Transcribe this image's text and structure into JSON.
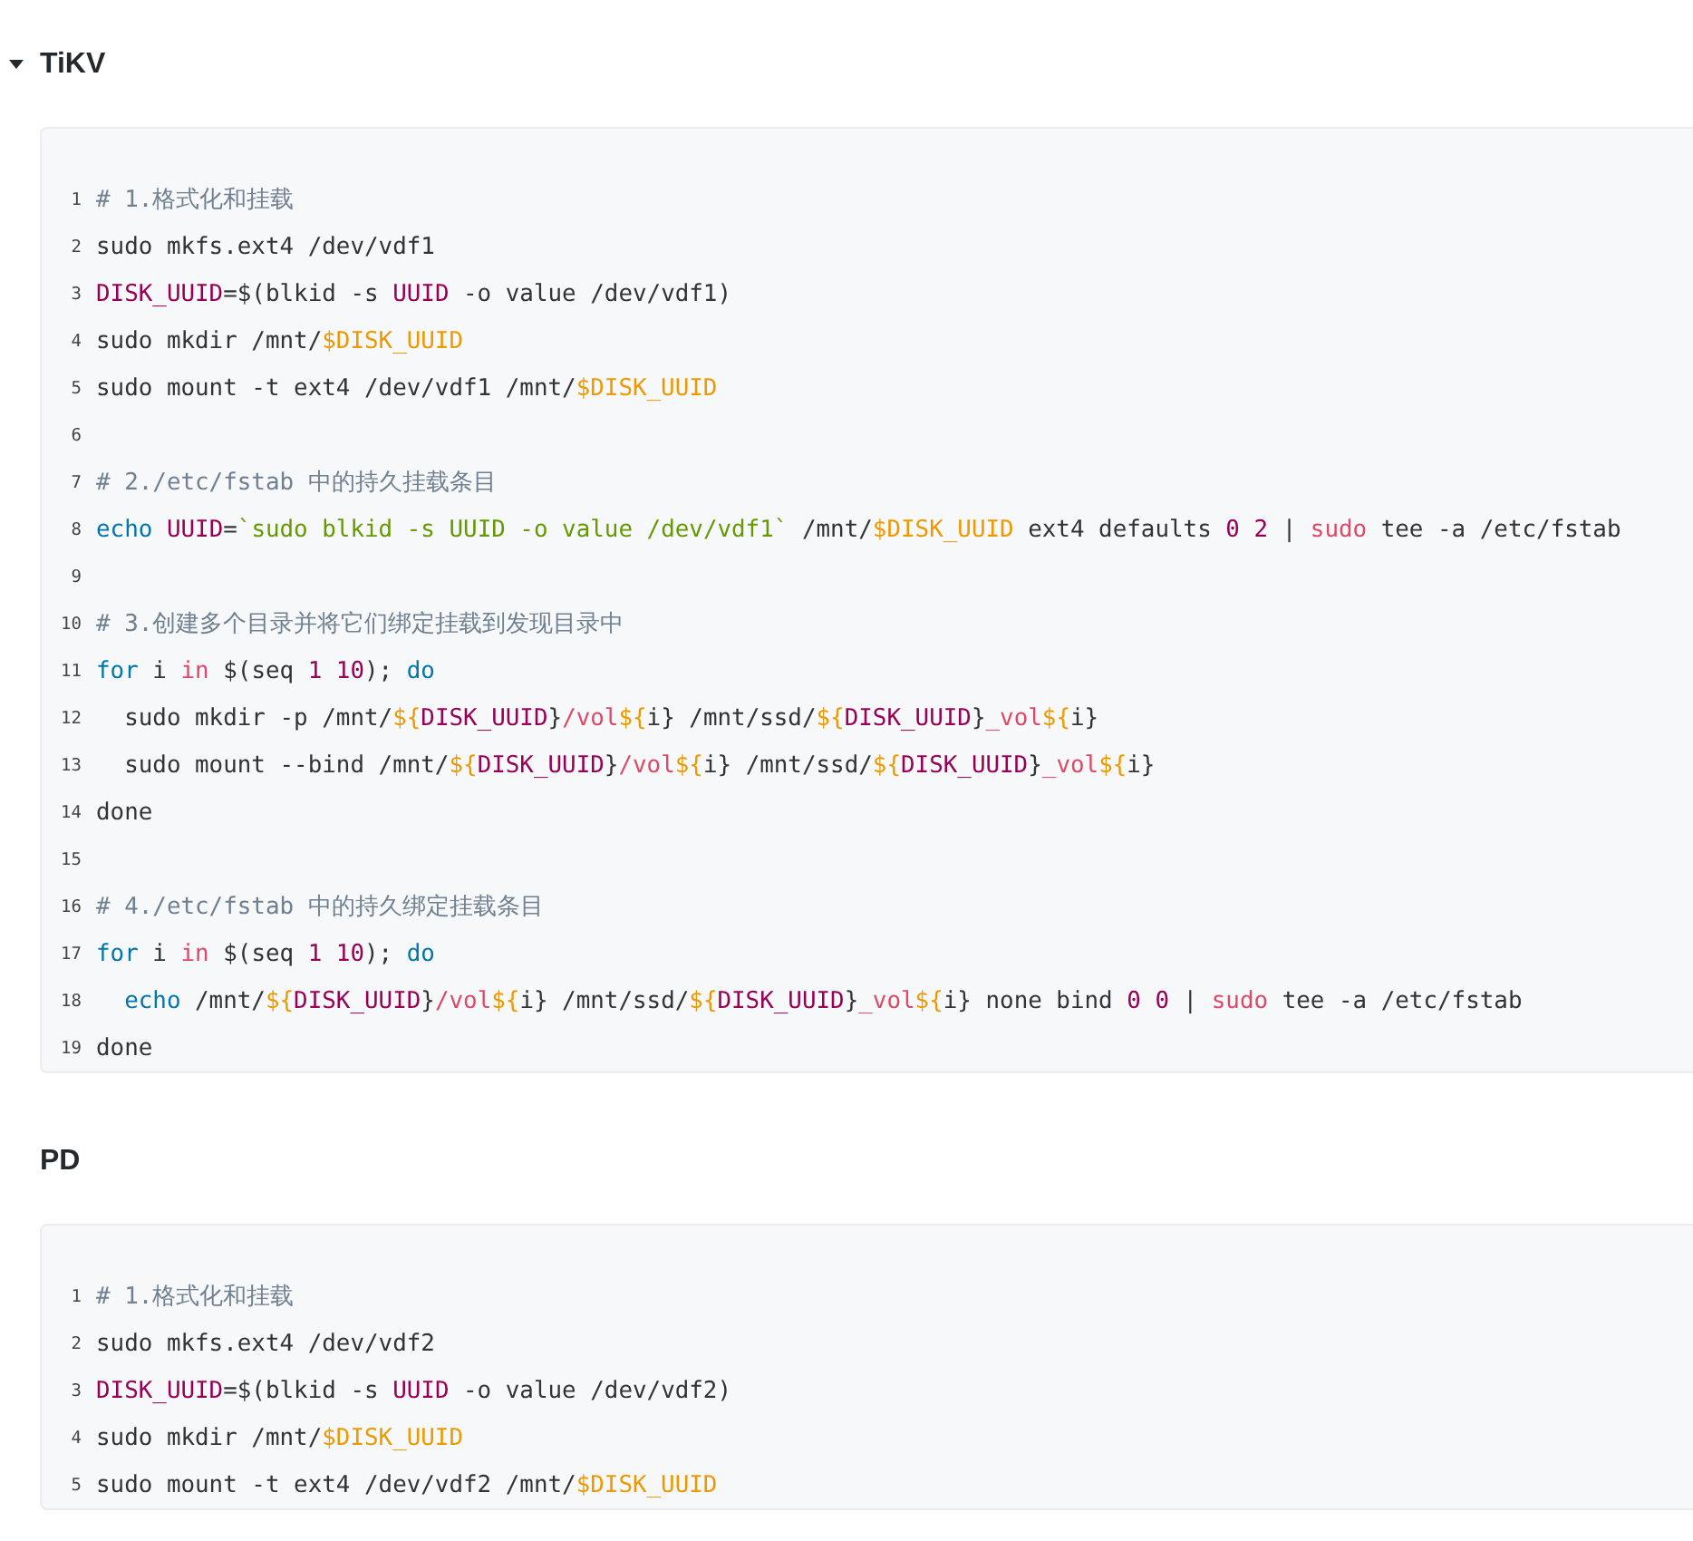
{
  "sections": [
    {
      "title": "TiKV",
      "expanded": true,
      "lines": [
        {
          "number": "1",
          "tokens": [
            {
              "kind": "comment",
              "text": "# 1.格式化和挂载"
            }
          ]
        },
        {
          "number": "2",
          "tokens": [
            {
              "kind": "plain",
              "text": "sudo mkfs.ext4 /dev/vdf1"
            }
          ]
        },
        {
          "number": "3",
          "tokens": [
            {
              "kind": "variable",
              "text": "DISK_UUID"
            },
            {
              "kind": "plain",
              "text": "=$(blkid -s "
            },
            {
              "kind": "variable",
              "text": "UUID"
            },
            {
              "kind": "plain",
              "text": " -o value /dev/vdf1)"
            }
          ]
        },
        {
          "number": "4",
          "tokens": [
            {
              "kind": "plain",
              "text": "sudo mkdir /mnt/"
            },
            {
              "kind": "expansion",
              "text": "$DISK_UUID"
            }
          ]
        },
        {
          "number": "5",
          "tokens": [
            {
              "kind": "plain",
              "text": "sudo mount -t ext4 /dev/vdf1 /mnt/"
            },
            {
              "kind": "expansion",
              "text": "$DISK_UUID"
            }
          ]
        },
        {
          "number": "6"
        },
        {
          "number": "7",
          "tokens": [
            {
              "kind": "comment",
              "text": "# 2./etc/fstab 中的持久挂载条目"
            }
          ]
        },
        {
          "number": "8",
          "tokens": [
            {
              "kind": "keyword",
              "text": "echo "
            },
            {
              "kind": "variable",
              "text": "UUID"
            },
            {
              "kind": "plain",
              "text": "="
            },
            {
              "kind": "string",
              "text": "`sudo blkid -s UUID -o value /dev/vdf1`"
            },
            {
              "kind": "plain",
              "text": " /mnt/"
            },
            {
              "kind": "expansion",
              "text": "$DISK_UUID"
            },
            {
              "kind": "plain",
              "text": " ext4 defaults "
            },
            {
              "kind": "number",
              "text": "0 2"
            },
            {
              "kind": "plain",
              "text": " | "
            },
            {
              "kind": "operator",
              "text": "sudo"
            },
            {
              "kind": "plain",
              "text": " tee -a /etc/fstab"
            }
          ]
        },
        {
          "number": "9"
        },
        {
          "number": "10",
          "tokens": [
            {
              "kind": "comment",
              "text": "# 3.创建多个目录并将它们绑定挂载到发现目录中"
            }
          ]
        },
        {
          "number": "11",
          "tokens": [
            {
              "kind": "keyword",
              "text": "for"
            },
            {
              "kind": "plain",
              "text": " i "
            },
            {
              "kind": "operator",
              "text": "in"
            },
            {
              "kind": "plain",
              "text": " $(seq "
            },
            {
              "kind": "number",
              "text": "1 10"
            },
            {
              "kind": "plain",
              "text": "); "
            },
            {
              "kind": "keyword",
              "text": "do"
            }
          ]
        },
        {
          "number": "12",
          "tokens": [
            {
              "kind": "plain",
              "text": "  sudo mkdir -p /mnt/"
            },
            {
              "kind": "expansion",
              "text": "${"
            },
            {
              "kind": "variable",
              "text": "DISK_UUID"
            },
            {
              "kind": "plain",
              "text": "}"
            },
            {
              "kind": "operator",
              "text": "/vol"
            },
            {
              "kind": "expansion",
              "text": "${"
            },
            {
              "kind": "plain",
              "text": "i} /mnt/ssd/"
            },
            {
              "kind": "expansion",
              "text": "${"
            },
            {
              "kind": "variable",
              "text": "DISK_UUID"
            },
            {
              "kind": "plain",
              "text": "}"
            },
            {
              "kind": "operator",
              "text": "_vol"
            },
            {
              "kind": "expansion",
              "text": "${"
            },
            {
              "kind": "plain",
              "text": "i}"
            }
          ]
        },
        {
          "number": "13",
          "tokens": [
            {
              "kind": "plain",
              "text": "  sudo mount --bind /mnt/"
            },
            {
              "kind": "expansion",
              "text": "${"
            },
            {
              "kind": "variable",
              "text": "DISK_UUID"
            },
            {
              "kind": "plain",
              "text": "}"
            },
            {
              "kind": "operator",
              "text": "/vol"
            },
            {
              "kind": "expansion",
              "text": "${"
            },
            {
              "kind": "plain",
              "text": "i} /mnt/ssd/"
            },
            {
              "kind": "expansion",
              "text": "${"
            },
            {
              "kind": "variable",
              "text": "DISK_UUID"
            },
            {
              "kind": "plain",
              "text": "}"
            },
            {
              "kind": "operator",
              "text": "_vol"
            },
            {
              "kind": "expansion",
              "text": "${"
            },
            {
              "kind": "plain",
              "text": "i}"
            }
          ]
        },
        {
          "number": "14",
          "tokens": [
            {
              "kind": "plain",
              "text": "done"
            }
          ]
        },
        {
          "number": "15"
        },
        {
          "number": "16",
          "tokens": [
            {
              "kind": "comment",
              "text": "# 4./etc/fstab 中的持久绑定挂载条目"
            }
          ]
        },
        {
          "number": "17",
          "tokens": [
            {
              "kind": "keyword",
              "text": "for"
            },
            {
              "kind": "plain",
              "text": " i "
            },
            {
              "kind": "operator",
              "text": "in"
            },
            {
              "kind": "plain",
              "text": " $(seq "
            },
            {
              "kind": "number",
              "text": "1 10"
            },
            {
              "kind": "plain",
              "text": "); "
            },
            {
              "kind": "keyword",
              "text": "do"
            }
          ]
        },
        {
          "number": "18",
          "tokens": [
            {
              "kind": "keyword",
              "text": "  echo"
            },
            {
              "kind": "plain",
              "text": " /mnt/"
            },
            {
              "kind": "expansion",
              "text": "${"
            },
            {
              "kind": "variable",
              "text": "DISK_UUID"
            },
            {
              "kind": "plain",
              "text": "}"
            },
            {
              "kind": "operator",
              "text": "/vol"
            },
            {
              "kind": "expansion",
              "text": "${"
            },
            {
              "kind": "plain",
              "text": "i} /mnt/ssd/"
            },
            {
              "kind": "expansion",
              "text": "${"
            },
            {
              "kind": "variable",
              "text": "DISK_UUID"
            },
            {
              "kind": "plain",
              "text": "}"
            },
            {
              "kind": "operator",
              "text": "_vol"
            },
            {
              "kind": "expansion",
              "text": "${"
            },
            {
              "kind": "plain",
              "text": "i} none bind "
            },
            {
              "kind": "number",
              "text": "0 0"
            },
            {
              "kind": "plain",
              "text": " | "
            },
            {
              "kind": "operator",
              "text": "sudo"
            },
            {
              "kind": "plain",
              "text": " tee -a /etc/fstab"
            }
          ]
        },
        {
          "number": "19",
          "tokens": [
            {
              "kind": "plain",
              "text": "done"
            }
          ]
        }
      ]
    },
    {
      "title": "PD",
      "lines": [
        {
          "number": "1",
          "tokens": [
            {
              "kind": "comment",
              "text": "# 1.格式化和挂载"
            }
          ]
        },
        {
          "number": "2",
          "tokens": [
            {
              "kind": "plain",
              "text": "sudo mkfs.ext4 /dev/vdf2"
            }
          ]
        },
        {
          "number": "3",
          "tokens": [
            {
              "kind": "variable",
              "text": "DISK_UUID"
            },
            {
              "kind": "plain",
              "text": "=$(blkid -s "
            },
            {
              "kind": "variable",
              "text": "UUID"
            },
            {
              "kind": "plain",
              "text": " -o value /dev/vdf2)"
            }
          ]
        },
        {
          "number": "4",
          "tokens": [
            {
              "kind": "plain",
              "text": "sudo mkdir /mnt/"
            },
            {
              "kind": "expansion",
              "text": "$DISK_UUID"
            }
          ]
        },
        {
          "number": "5",
          "tokens": [
            {
              "kind": "plain",
              "text": "sudo mount -t ext4 /dev/vdf2 /mnt/"
            },
            {
              "kind": "expansion",
              "text": "$DISK_UUID"
            }
          ]
        }
      ]
    }
  ]
}
